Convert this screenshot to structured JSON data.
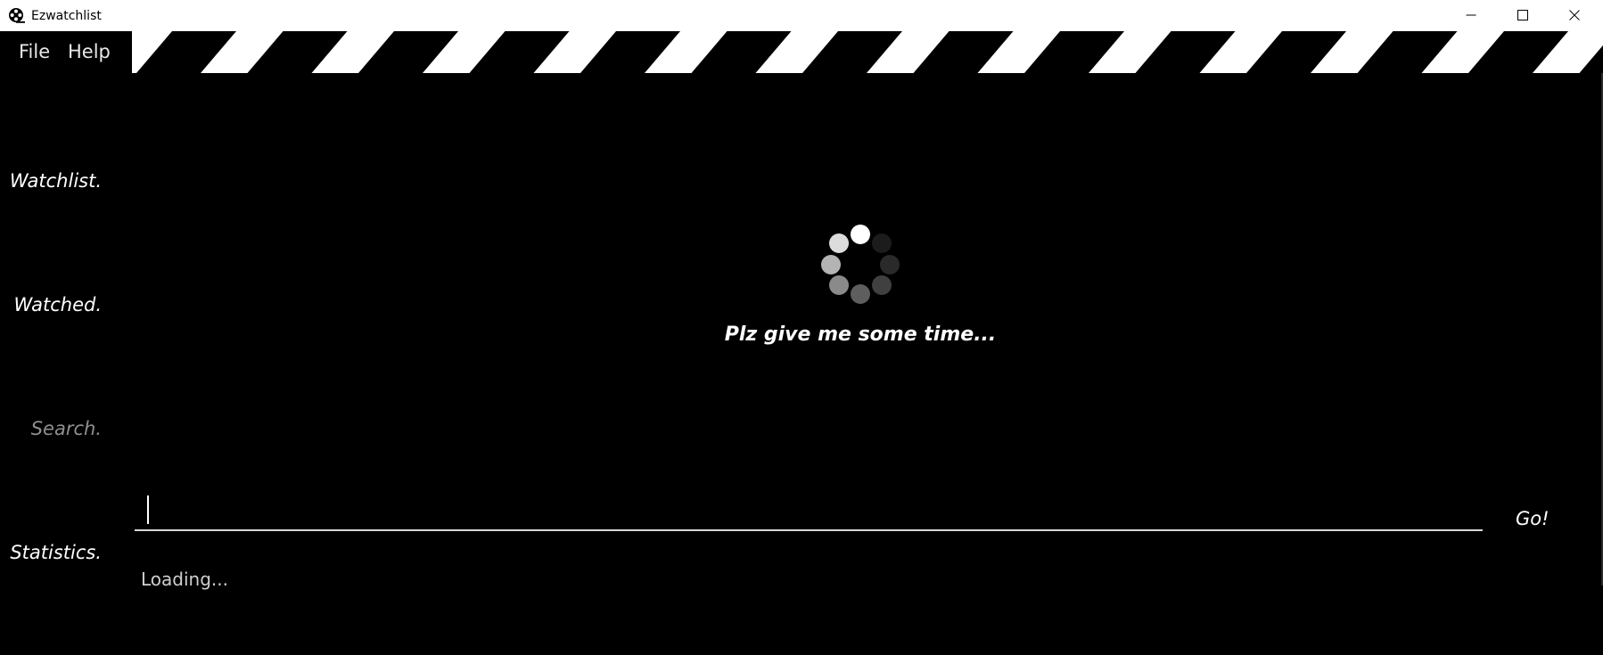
{
  "window": {
    "title": "Ezwatchlist",
    "app_icon": "film-reel-icon",
    "controls": [
      "minimize-icon",
      "maximize-icon",
      "close-icon"
    ]
  },
  "menu": {
    "file": "File",
    "help": "Help"
  },
  "nav": {
    "watchlist": "Watchlist.",
    "watched": "Watched.",
    "search": "Search.",
    "statistics": "Statistics."
  },
  "loader": {
    "message": "Plz give me some time...",
    "icon": "spinner-icon"
  },
  "search": {
    "value": "",
    "go_label": "Go!",
    "status": "Loading..."
  },
  "colors": {
    "background": "#000000",
    "titlebar": "#ffffff",
    "text": "#ffffff",
    "muted": "#8f8f8f",
    "status": "#cfcfcf"
  }
}
